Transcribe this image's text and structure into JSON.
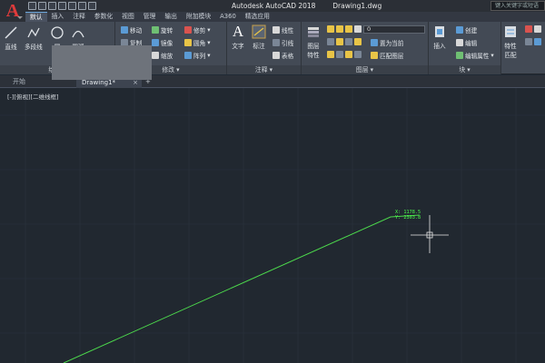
{
  "app": {
    "title": "Autodesk AutoCAD 2018",
    "file": "Drawing1.dwg",
    "search_placeholder": "键入关键字或短语",
    "logo_letter": "A"
  },
  "ribbon_tabs": [
    "默认",
    "插入",
    "注释",
    "参数化",
    "视图",
    "管理",
    "输出",
    "附加模块",
    "A360",
    "精选应用"
  ],
  "panels": {
    "draw": "绘图",
    "modify": "修改",
    "annotation": "注释",
    "layers": "图层",
    "block": "块"
  },
  "tools": {
    "line": "直线",
    "polyline": "多段线",
    "circle": "圆",
    "arc": "圆弧",
    "move": "移动",
    "rotate": "旋转",
    "trim": "修剪",
    "copy": "复制",
    "mirror": "镜像",
    "fillet": "圆角",
    "stretch": "拉伸",
    "scale": "缩放",
    "array": "阵列",
    "text": "文字",
    "dimension": "标注",
    "linear": "线性",
    "leader": "引线",
    "table": "表格",
    "layer_props_1": "图层",
    "layer_props_2": "特性",
    "layer_value": "0",
    "make_current": "置为当前",
    "match_layer": "匹配图层",
    "insert": "插入",
    "create": "创建",
    "edit": "编辑",
    "edit_attributes": "编辑属性",
    "properties_1": "特性",
    "properties_2": "匹配"
  },
  "file_tabs": {
    "start": "开始",
    "drawing": "Drawing1*"
  },
  "viewport_label": "[-][俯视][二维线框]",
  "dynamic_input": {
    "x": "X: 1178.5",
    "y": "Y: 2303.8"
  },
  "colors": {
    "canvas": "#212830",
    "line": "#4cd94c",
    "crosshair": "#e8e8e8",
    "accent": "#e03b3b"
  }
}
